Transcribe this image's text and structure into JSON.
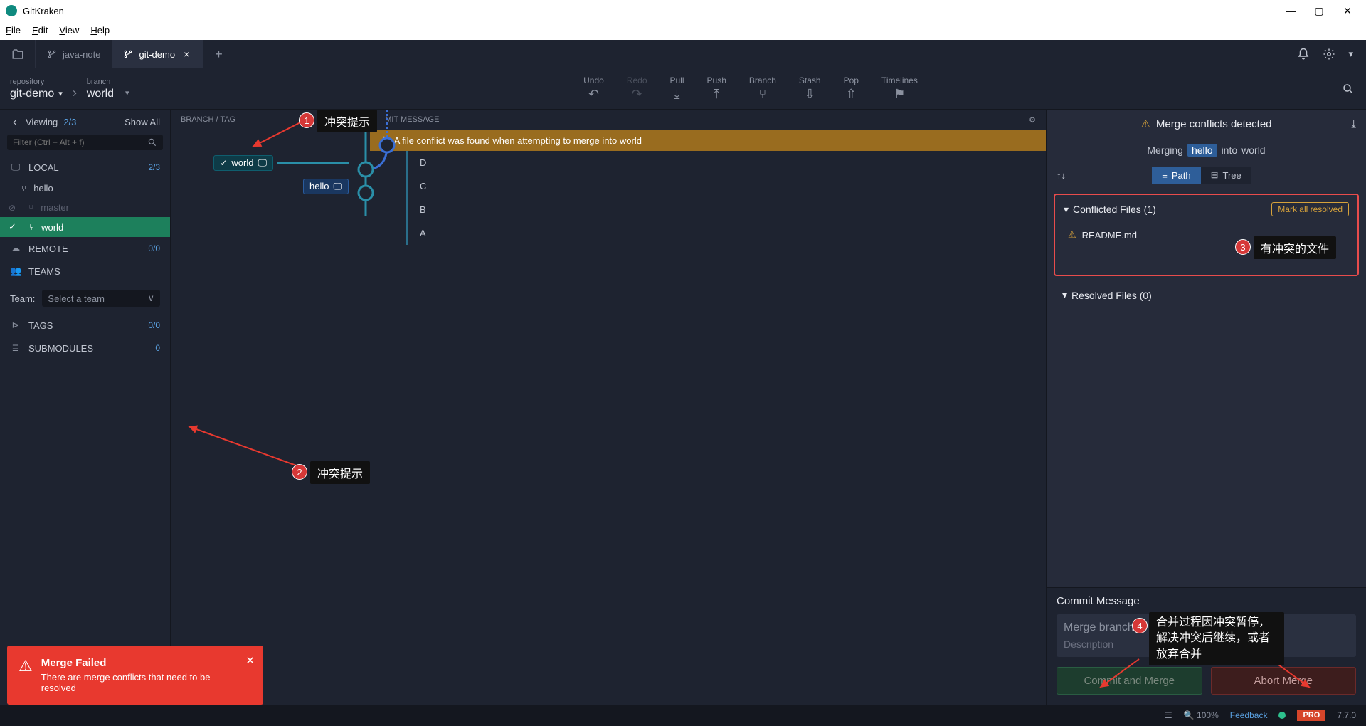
{
  "titlebar": {
    "title": "GitKraken"
  },
  "menubar": [
    "File",
    "Edit",
    "View",
    "Help"
  ],
  "tabs": {
    "items": [
      {
        "label": "java-note",
        "active": false
      },
      {
        "label": "git-demo",
        "active": true
      }
    ]
  },
  "toolbar": {
    "repo": {
      "label": "repository",
      "value": "git-demo"
    },
    "branch": {
      "label": "branch",
      "value": "world"
    },
    "actions": [
      {
        "label": "Undo"
      },
      {
        "label": "Redo"
      },
      {
        "label": "Pull"
      },
      {
        "label": "Push"
      },
      {
        "label": "Branch"
      },
      {
        "label": "Stash"
      },
      {
        "label": "Pop"
      },
      {
        "label": "Timelines"
      }
    ]
  },
  "sidebar": {
    "viewing_label": "Viewing",
    "viewing_count": "2/3",
    "showall": "Show All",
    "filter_placeholder": "Filter (Ctrl + Alt + f)",
    "sections": {
      "local": {
        "label": "LOCAL",
        "count": "2/3",
        "branches": [
          {
            "name": "hello",
            "state": "normal"
          },
          {
            "name": "master",
            "state": "dim"
          },
          {
            "name": "world",
            "state": "active"
          }
        ]
      },
      "remote": {
        "label": "REMOTE",
        "count": "0/0"
      },
      "teams": {
        "label": "TEAMS"
      },
      "tags": {
        "label": "TAGS",
        "count": "0/0"
      },
      "submodules": {
        "label": "SUBMODULES",
        "count": "0"
      }
    },
    "team_label": "Team:",
    "team_select": "Select a team"
  },
  "graph": {
    "header": "BRANCH / TAG",
    "header_right": "MIT MESSAGE",
    "banner_text": "A file conflict was found when attempting to merge into world",
    "rows": [
      {
        "branches": [
          "world"
        ],
        "msg": "D",
        "checked": true
      },
      {
        "branches": [
          "hello"
        ],
        "msg": "C"
      },
      {
        "branches": [],
        "msg": "B"
      },
      {
        "branches": [],
        "msg": "A"
      }
    ]
  },
  "annotations": {
    "n1": "冲突提示",
    "n2": "冲突提示",
    "n3": "有冲突的文件",
    "n4": "合并过程因冲突暂停，解决冲突后继续，或者放弃合并"
  },
  "right": {
    "header": "Merge conflicts detected",
    "merging_label": "Merging",
    "merging_src": "hello",
    "merging_into": "into",
    "merging_dst": "world",
    "view_path": "Path",
    "view_tree": "Tree",
    "conflicted_label": "Conflicted Files (1)",
    "mark_all": "Mark all resolved",
    "conflicted_files": [
      "README.md"
    ],
    "resolved_label": "Resolved Files (0)",
    "commit_msg_label": "Commit Message",
    "commit_title": "Merge branch",
    "commit_desc": "Description",
    "btn_commit": "Commit and Merge",
    "btn_abort": "Abort Merge"
  },
  "toast": {
    "title": "Merge Failed",
    "body": "There are merge conflicts that need to be resolved"
  },
  "statusbar": {
    "zoom": "100%",
    "feedback": "Feedback",
    "pro": "PRO",
    "version": "7.7.0"
  }
}
